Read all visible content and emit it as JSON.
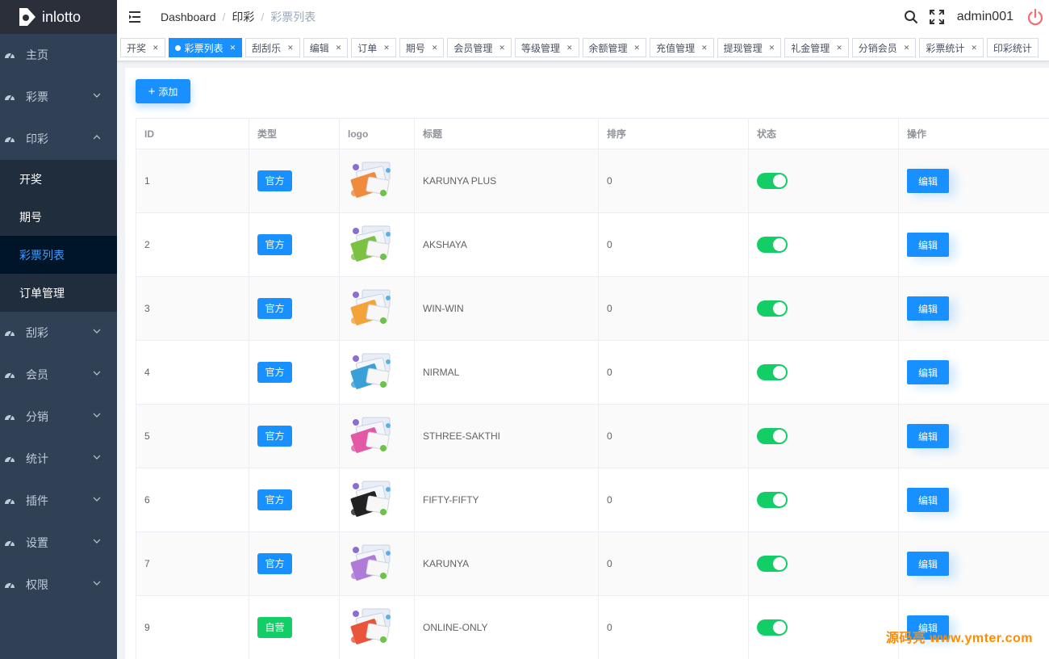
{
  "app": {
    "name": "inlotto"
  },
  "sidebar": {
    "items": [
      {
        "label": "主页",
        "expandable": false
      },
      {
        "label": "彩票",
        "expandable": true
      },
      {
        "label": "印彩",
        "expandable": true,
        "open": true,
        "children": [
          {
            "label": "开奖",
            "active": false
          },
          {
            "label": "期号",
            "active": false
          },
          {
            "label": "彩票列表",
            "active": true
          },
          {
            "label": "订单管理",
            "active": false
          }
        ]
      },
      {
        "label": "刮彩",
        "expandable": true
      },
      {
        "label": "会员",
        "expandable": true
      },
      {
        "label": "分销",
        "expandable": true
      },
      {
        "label": "统计",
        "expandable": true
      },
      {
        "label": "插件",
        "expandable": true
      },
      {
        "label": "设置",
        "expandable": true
      },
      {
        "label": "权限",
        "expandable": true
      }
    ]
  },
  "header": {
    "breadcrumb": [
      "Dashboard",
      "印彩",
      "彩票列表"
    ],
    "username": "admin001"
  },
  "tags": [
    {
      "label": "开奖",
      "active": false
    },
    {
      "label": "彩票列表",
      "active": true
    },
    {
      "label": "刮刮乐",
      "active": false
    },
    {
      "label": "编辑",
      "active": false
    },
    {
      "label": "订单",
      "active": false
    },
    {
      "label": "期号",
      "active": false
    },
    {
      "label": "会员管理",
      "active": false
    },
    {
      "label": "等级管理",
      "active": false
    },
    {
      "label": "余额管理",
      "active": false
    },
    {
      "label": "充值管理",
      "active": false
    },
    {
      "label": "提现管理",
      "active": false
    },
    {
      "label": "礼金管理",
      "active": false
    },
    {
      "label": "分销会员",
      "active": false
    },
    {
      "label": "彩票统计",
      "active": false
    },
    {
      "label": "印彩统计",
      "active": false
    }
  ],
  "toolbar": {
    "add_label": "添加"
  },
  "table": {
    "columns": [
      "ID",
      "类型",
      "logo",
      "标题",
      "排序",
      "状态",
      "操作"
    ],
    "edit_label": "编辑",
    "rows": [
      {
        "id": "1",
        "type": "官方",
        "type_kind": "official",
        "title": "KARUNYA PLUS",
        "sort": "0",
        "status": true,
        "logo_color": "#f08a3c"
      },
      {
        "id": "2",
        "type": "官方",
        "type_kind": "official",
        "title": "AKSHAYA",
        "sort": "0",
        "status": true,
        "logo_color": "#7cc242"
      },
      {
        "id": "3",
        "type": "官方",
        "type_kind": "official",
        "title": "WIN-WIN",
        "sort": "0",
        "status": true,
        "logo_color": "#f2a33a"
      },
      {
        "id": "4",
        "type": "官方",
        "type_kind": "official",
        "title": "NIRMAL",
        "sort": "0",
        "status": true,
        "logo_color": "#3aa0d8"
      },
      {
        "id": "5",
        "type": "官方",
        "type_kind": "official",
        "title": "STHREE-SAKTHI",
        "sort": "0",
        "status": true,
        "logo_color": "#e25aa6"
      },
      {
        "id": "6",
        "type": "官方",
        "type_kind": "official",
        "title": "FIFTY-FIFTY",
        "sort": "0",
        "status": true,
        "logo_color": "#222222"
      },
      {
        "id": "7",
        "type": "官方",
        "type_kind": "official",
        "title": "KARUNYA",
        "sort": "0",
        "status": true,
        "logo_color": "#b07ad8"
      },
      {
        "id": "9",
        "type": "自营",
        "type_kind": "self",
        "title": "ONLINE-ONLY",
        "sort": "0",
        "status": true,
        "logo_color": "#e8553a"
      }
    ]
  },
  "watermark": "源码亮 www.ymter.com",
  "colors": {
    "primary": "#1890ff",
    "success": "#13ce66",
    "sidebar_bg": "#304156",
    "danger": "#f56c6c"
  }
}
